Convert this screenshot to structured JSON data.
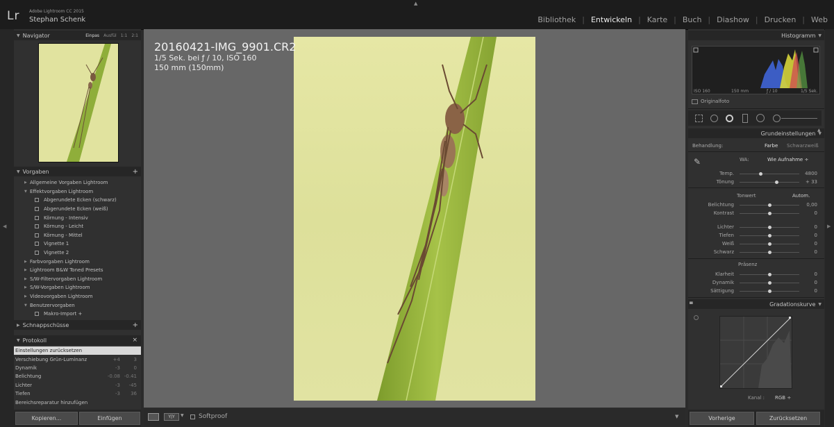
{
  "app": {
    "logo": "Lr",
    "version": "Adobe Lightroom CC 2015",
    "user": "Stephan Schenk"
  },
  "modules": [
    {
      "label": "Bibliothek",
      "active": false
    },
    {
      "label": "Entwickeln",
      "active": true
    },
    {
      "label": "Karte",
      "active": false
    },
    {
      "label": "Buch",
      "active": false
    },
    {
      "label": "Diashow",
      "active": false
    },
    {
      "label": "Drucken",
      "active": false
    },
    {
      "label": "Web",
      "active": false
    }
  ],
  "navigator": {
    "title": "Navigator",
    "zoom": [
      "Einpas",
      "Ausfül",
      "1:1",
      "2:1"
    ]
  },
  "presets": {
    "title": "Vorgaben",
    "add": "+",
    "items": [
      {
        "label": "Allgemeine Vorgaben Lightroom",
        "level": 0,
        "open": false,
        "icon": false
      },
      {
        "label": "Effektvorgaben Lightroom",
        "level": 0,
        "open": true,
        "icon": false
      },
      {
        "label": "Abgerundete Ecken (schwarz)",
        "level": 1,
        "open": false,
        "icon": true
      },
      {
        "label": "Abgerundete Ecken (weiß)",
        "level": 1,
        "open": false,
        "icon": true
      },
      {
        "label": "Körnung - Intensiv",
        "level": 1,
        "open": false,
        "icon": true
      },
      {
        "label": "Körnung - Leicht",
        "level": 1,
        "open": false,
        "icon": true
      },
      {
        "label": "Körnung - Mittel",
        "level": 1,
        "open": false,
        "icon": true
      },
      {
        "label": "Vignette 1",
        "level": 1,
        "open": false,
        "icon": true
      },
      {
        "label": "Vignette 2",
        "level": 1,
        "open": false,
        "icon": true
      },
      {
        "label": "Farbvorgaben Lightroom",
        "level": 0,
        "open": false,
        "icon": false
      },
      {
        "label": "Lightroom B&W Toned Presets",
        "level": 0,
        "open": false,
        "icon": false
      },
      {
        "label": "S/W-Filtervorgaben Lightroom",
        "level": 0,
        "open": false,
        "icon": false
      },
      {
        "label": "S/W-Vorgaben Lightroom",
        "level": 0,
        "open": false,
        "icon": false
      },
      {
        "label": "Videovorgaben Lightroom",
        "level": 0,
        "open": false,
        "icon": false
      },
      {
        "label": "Benutzervorgaben",
        "level": 0,
        "open": true,
        "icon": false
      },
      {
        "label": "Makro-Import  +",
        "level": 1,
        "open": false,
        "icon": true
      }
    ]
  },
  "snapshots": {
    "title": "Schnappschüsse",
    "add": "+"
  },
  "history": {
    "title": "Protokoll",
    "close": "×",
    "rows": [
      {
        "label": "Einstellungen zurücksetzen",
        "v1": "",
        "v2": "",
        "selected": true
      },
      {
        "label": "Verschiebung Grün-Luminanz",
        "v1": "+4",
        "v2": "3",
        "selected": false
      },
      {
        "label": "Dynamik",
        "v1": "-3",
        "v2": "0",
        "selected": false
      },
      {
        "label": "Belichtung",
        "v1": "-0.08",
        "v2": "-0.41",
        "selected": false
      },
      {
        "label": "Lichter",
        "v1": "-3",
        "v2": "-45",
        "selected": false
      },
      {
        "label": "Tiefen",
        "v1": "-3",
        "v2": "36",
        "selected": false
      },
      {
        "label": "Bereichsreparatur hinzufügen",
        "v1": "",
        "v2": "",
        "selected": false
      }
    ]
  },
  "left_buttons": {
    "copy": "Kopieren...",
    "paste": "Einfügen"
  },
  "photo_info": {
    "name": "20160421-IMG_9901.CR2",
    "exposure": "1/5 Sek. bei ƒ / 10, ISO 160",
    "lens": "150 mm (150mm)"
  },
  "toolbar": {
    "softproof": "Softproof",
    "view_mode": "Y|Y"
  },
  "histogram": {
    "title": "Histogramm",
    "iso": "ISO 160",
    "focal": "150 mm",
    "aperture": "ƒ / 10",
    "shutter": "1/5 Sek.",
    "original": "Originalfoto"
  },
  "basic": {
    "title": "Grundeinstellungen",
    "treatment_label": "Behandlung:",
    "treatment_color": "Farbe",
    "treatment_bw": "Schwarzweiß",
    "wb_label": "WA:",
    "wb_value": "Wie Aufnahme ÷",
    "tone_label": "Tonwert",
    "auto": "Autom.",
    "presence_label": "Präsenz",
    "sliders_wb": [
      {
        "label": "Temp.",
        "value": "4800",
        "pos": 0.35
      },
      {
        "label": "Tönung",
        "value": "+ 33",
        "pos": 0.62
      }
    ],
    "sliders_tone": [
      {
        "label": "Belichtung",
        "value": "0,00",
        "pos": 0.5
      },
      {
        "label": "Kontrast",
        "value": "0",
        "pos": 0.5
      }
    ],
    "sliders_tone2": [
      {
        "label": "Lichter",
        "value": "0",
        "pos": 0.5
      },
      {
        "label": "Tiefen",
        "value": "0",
        "pos": 0.5
      },
      {
        "label": "Weiß",
        "value": "0",
        "pos": 0.5
      },
      {
        "label": "Schwarz",
        "value": "0",
        "pos": 0.5
      }
    ],
    "sliders_presence": [
      {
        "label": "Klarheit",
        "value": "0",
        "pos": 0.5
      },
      {
        "label": "Dynamik",
        "value": "0",
        "pos": 0.5
      },
      {
        "label": "Sättigung",
        "value": "0",
        "pos": 0.5
      }
    ]
  },
  "tone_curve": {
    "title": "Gradationskurve",
    "channel_label": "Kanal :",
    "channel_value": "RGB ÷"
  },
  "right_buttons": {
    "previous": "Vorherige",
    "reset": "Zurücksetzen"
  },
  "colors": {
    "accent": "#e6e7a5",
    "panel": "#303030",
    "header": "#262626"
  }
}
